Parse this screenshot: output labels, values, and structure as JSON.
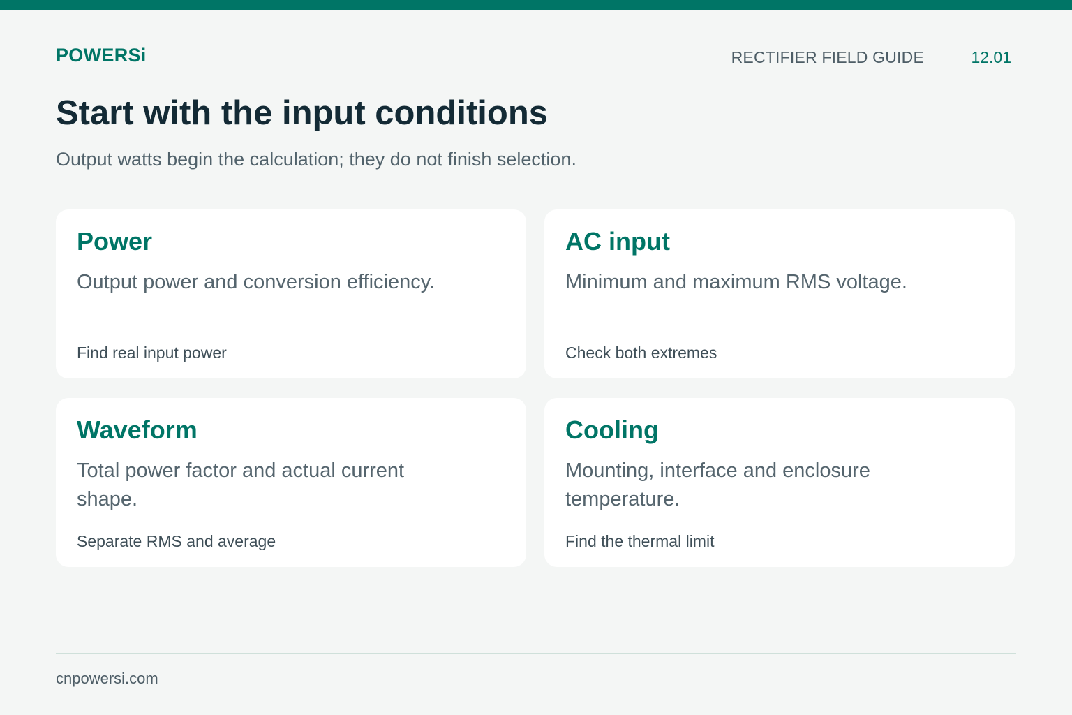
{
  "header": {
    "brand": "POWERSi",
    "guide_title": "RECTIFIER FIELD GUIDE",
    "page_number": "12.01"
  },
  "main": {
    "headline": "Start with the input conditions",
    "subhead": "Output watts begin the calculation; they do not finish selection.",
    "cards": [
      {
        "title": "Power",
        "description": "Output power and conversion efficiency.",
        "note": "Find real input power"
      },
      {
        "title": "AC input",
        "description": "Minimum and maximum RMS voltage.",
        "note": "Check both extremes"
      },
      {
        "title": "Waveform",
        "description": "Total power factor and actual current shape.",
        "note": "Separate RMS and average"
      },
      {
        "title": "Cooling",
        "description": "Mounting, interface and enclosure temperature.",
        "note": "Find the thermal limit"
      }
    ]
  },
  "footer": {
    "url": "cnpowersi.com"
  },
  "colors": {
    "accent": "#007566",
    "background": "#f4f6f5",
    "card": "#ffffff",
    "heading": "#132a35",
    "muted_text": "#55656e"
  }
}
